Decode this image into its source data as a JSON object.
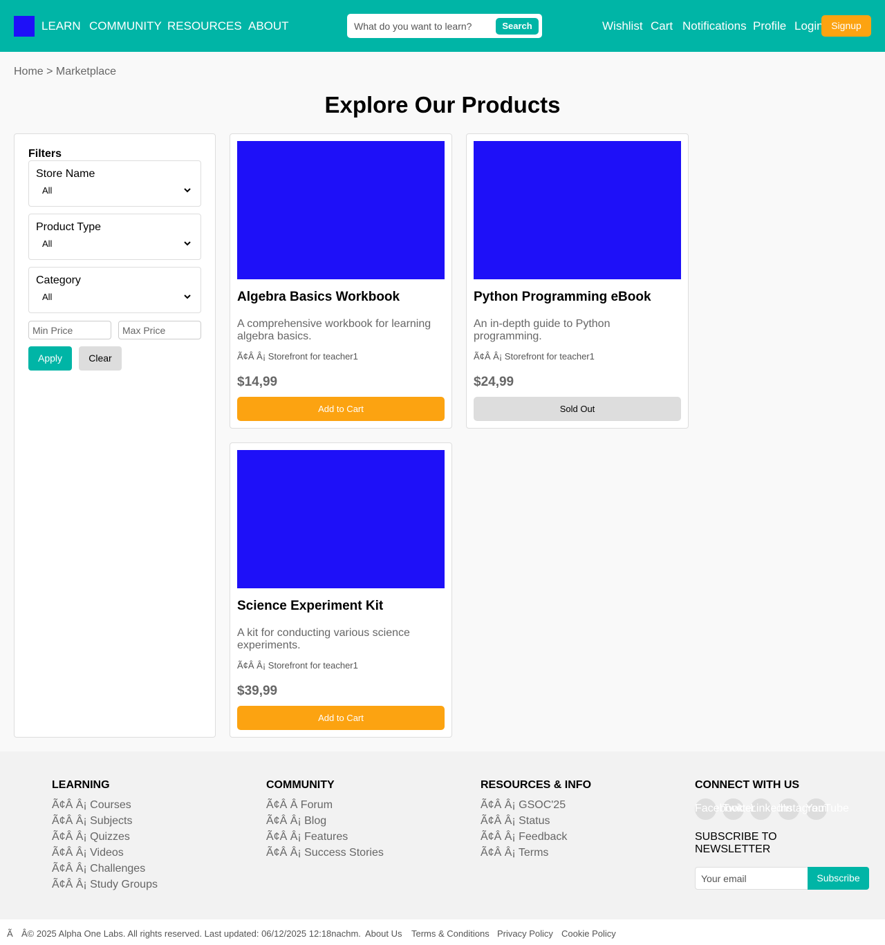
{
  "header": {
    "nav": [
      "LEARN",
      "COMMUNITY",
      "RESOURCES",
      "ABOUT"
    ],
    "search": {
      "placeholder": "What do you want to learn?",
      "button": "Search"
    },
    "user_links": [
      "Wishlist",
      "Cart",
      "Notifications",
      "Profile",
      "Login"
    ],
    "signup": "Signup",
    "colors": {
      "bar": "#00b5a6",
      "logo": "#1e10f8",
      "signup": "#fca311"
    }
  },
  "breadcrumb": {
    "home": "Home",
    "sep": " > ",
    "current": "Marketplace"
  },
  "page_title": "Explore Our Products",
  "filters": {
    "title": "Filters",
    "groups": [
      {
        "label": "Store Name",
        "value": "All"
      },
      {
        "label": "Product Type",
        "value": "All"
      },
      {
        "label": "Category",
        "value": "All"
      }
    ],
    "min_price_placeholder": "Min Price",
    "max_price_placeholder": "Max Price",
    "apply": "Apply",
    "clear": "Clear"
  },
  "products": [
    {
      "title": "Algebra Basics Workbook",
      "description": "A comprehensive workbook for learning algebra basics.",
      "store": "Ã¢Â Â¡ Storefront for teacher1",
      "price": "$14,99",
      "button": "Add to Cart"
    },
    {
      "title": "Python Programming eBook",
      "description": "An in-depth guide to Python programming.",
      "store": "Ã¢Â Â¡ Storefront for teacher1",
      "price": "$24,99",
      "button": "Sold Out"
    },
    {
      "title": "Science Experiment Kit",
      "description": "A kit for conducting various science experiments.",
      "store": "Ã¢Â Â¡ Storefront for teacher1",
      "price": "$39,99",
      "button": "Add to Cart"
    }
  ],
  "footer": {
    "learning": {
      "heading": "LEARNING",
      "links": [
        "Ã¢Â Â¡ Courses",
        "Ã¢Â Â¡ Subjects",
        "Ã¢Â Â¡ Quizzes",
        "Ã¢Â Â¡ Videos",
        "Ã¢Â Â¡ Challenges",
        "Ã¢Â Â¡ Study Groups"
      ]
    },
    "community": {
      "heading": "COMMUNITY",
      "links": [
        "Ã¢Â Â Forum",
        "Ã¢Â Â¡ Blog",
        "Ã¢Â Â¡ Features",
        "Ã¢Â Â¡ Success Stories"
      ]
    },
    "resources": {
      "heading": "RESOURCES & INFO",
      "links": [
        "Ã¢Â Â¡ GSOC'25",
        "Ã¢Â Â¡ Status",
        "Ã¢Â Â¡ Feedback",
        "Ã¢Â Â¡ Terms"
      ]
    },
    "connect": {
      "heading": "CONNECT WITH US",
      "social": [
        "Facebook",
        "Twitter",
        "LinkedIn",
        "Instagram",
        "YouTube"
      ],
      "newsletter_title": "SUBSCRIBE TO NEWSLETTER",
      "email_placeholder": "Your email",
      "subscribe": "Subscribe"
    }
  },
  "bottom_bar": {
    "prefix": "Ã",
    "copyright": "Â© 2025 Alpha One Labs. All rights reserved. Last updated: 06/12/2025 12:18nachm.",
    "links": [
      "About Us",
      "Terms & Conditions",
      "Privacy Policy",
      "Cookie Policy"
    ]
  }
}
